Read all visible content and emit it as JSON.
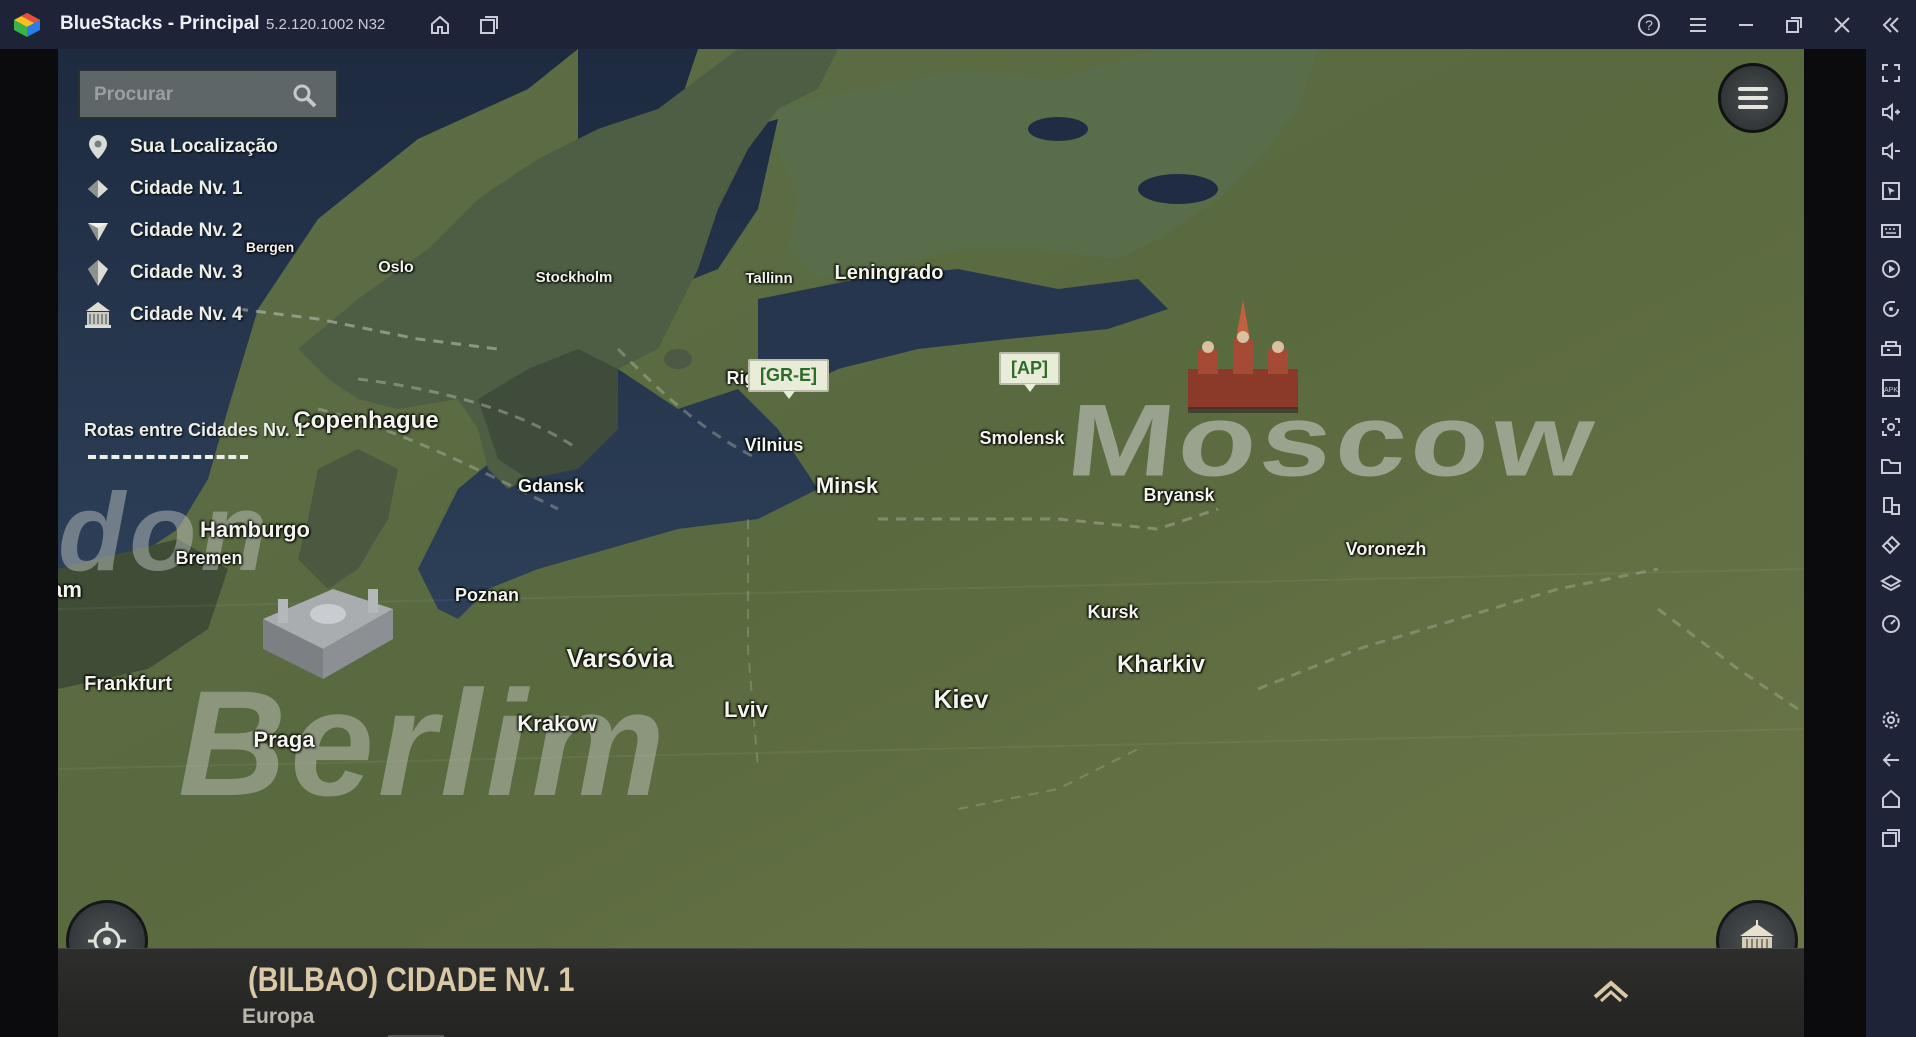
{
  "titlebar": {
    "app_title": "BlueStacks - Principal",
    "version": "5.2.120.1002 N32"
  },
  "search": {
    "placeholder": "Procurar"
  },
  "legend": {
    "items": [
      {
        "label": "Sua Localização",
        "icon": "location-pin-icon"
      },
      {
        "label": "Cidade Nv. 1",
        "icon": "city-level1-icon"
      },
      {
        "label": "Cidade Nv. 2",
        "icon": "city-level2-icon"
      },
      {
        "label": "Cidade Nv. 3",
        "icon": "city-level3-icon"
      },
      {
        "label": "Cidade Nv. 4",
        "icon": "city-level4-icon"
      }
    ],
    "routes_label": "Rotas entre Cidades Nv. 1"
  },
  "map": {
    "region_labels": {
      "moscow": "Moscow",
      "berlin": "Berlim",
      "london_partial": "don",
      "amsterdam_partial": "am"
    },
    "cities": [
      {
        "name": "Bergen",
        "level": 1
      },
      {
        "name": "Oslo",
        "level": 1
      },
      {
        "name": "Stockholm",
        "level": 1
      },
      {
        "name": "Tallinn",
        "level": 1
      },
      {
        "name": "Leningrado",
        "level": 2
      },
      {
        "name": "Riga",
        "level": 1
      },
      {
        "name": "Copenhague",
        "level": 3
      },
      {
        "name": "Vilnius",
        "level": 1
      },
      {
        "name": "Smolensk",
        "level": 1
      },
      {
        "name": "Gdansk",
        "level": 1
      },
      {
        "name": "Minsk",
        "level": 2
      },
      {
        "name": "Bryansk",
        "level": 1
      },
      {
        "name": "Hamburgo",
        "level": 2
      },
      {
        "name": "Bremen",
        "level": 1
      },
      {
        "name": "Voronezh",
        "level": 1
      },
      {
        "name": "Poznan",
        "level": 1
      },
      {
        "name": "Kursk",
        "level": 1
      },
      {
        "name": "Varsóvia",
        "level": 3
      },
      {
        "name": "Kharkiv",
        "level": 3
      },
      {
        "name": "Frankfurt",
        "level": 2
      },
      {
        "name": "Kiev",
        "level": 3
      },
      {
        "name": "Lviv",
        "level": 2
      },
      {
        "name": "Krakow",
        "level": 2
      },
      {
        "name": "Praga",
        "level": 2
      }
    ],
    "tags": [
      {
        "label": "[GR-E]"
      },
      {
        "label": "[AP]"
      }
    ]
  },
  "bottom_panel": {
    "title": "(BILBAO) CIDADE NV. 1",
    "subtitle": "Europa"
  },
  "colors": {
    "titlebar_bg": "#1e2338",
    "land": "#5a6b45",
    "water": "#22314a",
    "tag_text": "#2f6b2a",
    "panel_title": "#d9c9a6"
  }
}
